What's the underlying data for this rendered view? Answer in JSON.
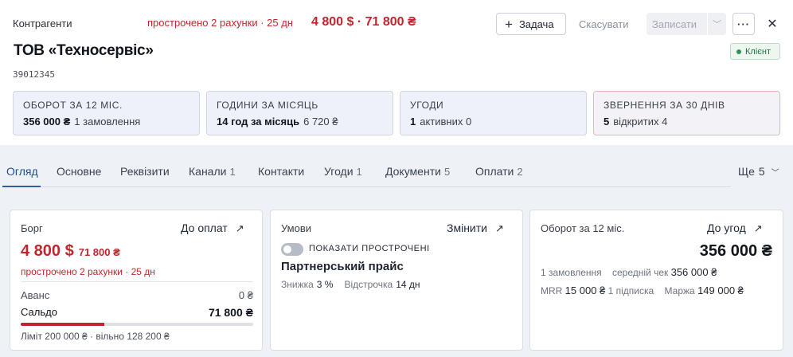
{
  "header": {
    "breadcrumb": "Контрагенти",
    "overdue_text": "прострочено 2 рахунки · 25 дн",
    "overdue_amount": "4 800 $ · 71 800 ₴",
    "buttons": {
      "task_icon": "plus-icon",
      "task": "Задача",
      "cancel": "Скасувати",
      "save": "Записати",
      "save_dropdown_icon": "chevron-down-icon",
      "more_icon": "more-horizontal-icon",
      "close_icon": "close-icon"
    },
    "company_name": "ТОВ «Техносервіс»",
    "edrpou": "39012345",
    "status_badge": "Клієнт",
    "status_color": "#2e9455"
  },
  "stats": [
    {
      "title": "Оборот за 12 міс.",
      "value": "356 000 ₴",
      "detail": "1 замовлення"
    },
    {
      "title": "Години за місяць",
      "value": "14 год за місяць",
      "detail": "6 720 ₴"
    },
    {
      "title": "Угоди",
      "value": "1",
      "detail": "активних 0"
    },
    {
      "title": "Звернення за 30 днів",
      "value": "5",
      "detail": "відкритих 4"
    }
  ],
  "tabs": [
    {
      "label": "Огляд",
      "count": ""
    },
    {
      "label": "Основне",
      "count": ""
    },
    {
      "label": "Реквізити",
      "count": ""
    },
    {
      "label": "Канали",
      "count": "1"
    },
    {
      "label": "Контакти",
      "count": ""
    },
    {
      "label": "Угоди",
      "count": "1"
    },
    {
      "label": "Документи",
      "count": "5"
    },
    {
      "label": "Оплати",
      "count": "2"
    }
  ],
  "tabs_more": {
    "label": "Ще",
    "count": "5",
    "icon": "chevron-down-icon"
  },
  "debt_card": {
    "title": "Борг",
    "link": "До оплат",
    "link_icon": "arrow-up-right-icon",
    "amount_usd": "4 800 $",
    "amount_uah": "71 800 ₴",
    "overdue": "прострочено 2 рахунки · 25 дн",
    "advance_label": "Аванс",
    "advance_value": "0 ₴",
    "balance_label": "Сальдо",
    "balance_value": "71 800 ₴",
    "limit_used_fraction": 0.36,
    "limit_text": "Ліміт 200 000 ₴ · вільно 128 200 ₴"
  },
  "terms_card": {
    "title": "Умови",
    "link": "Змінити",
    "link_icon": "arrow-up-right-icon",
    "toggle_label": "Показати прострочені",
    "toggle_on": false,
    "price_list": "Партнерський прайс",
    "discount_label": "Знижка",
    "discount_value": "3 %",
    "deferral_label": "Відстрочка",
    "deferral_value": "14 дн"
  },
  "turnover_card": {
    "title": "Оборот за 12 міс.",
    "link": "До угод",
    "link_icon": "arrow-up-right-icon",
    "amount": "356 000 ₴",
    "orders": "1 замовлення",
    "avg_label": "середній чек",
    "avg_value": "356 000 ₴",
    "mrr_label": "MRR",
    "mrr_value": "15 000 ₴",
    "subscriptions": "1 підписка",
    "margin_label": "Маржа",
    "margin_value": "149 000 ₴"
  },
  "colors": {
    "accent": "#2a5ea8",
    "danger": "#c0262d",
    "success": "#2e9455"
  }
}
